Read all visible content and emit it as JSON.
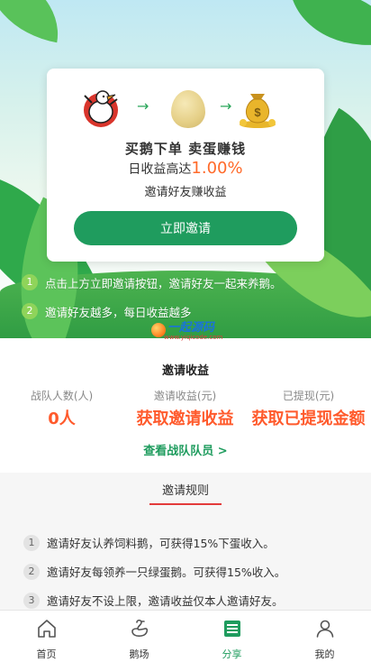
{
  "colors": {
    "accent": "#1f9c5e",
    "highlight": "#ff5a2c",
    "rules_underline": "#e33b3b"
  },
  "promo": {
    "headline": "买鹅下单  卖蛋赚钱",
    "rate_prefix": "日收益高达",
    "rate_value": "1.00%",
    "subline": "邀请好友赚收益",
    "invite_button": "立即邀请"
  },
  "steps": [
    {
      "num": "1",
      "text": "点击上方立即邀请按钮，邀请好友一起来养鹅。"
    },
    {
      "num": "2",
      "text": "邀请好友越多，每日收益越多"
    }
  ],
  "watermark": {
    "text": "一起源码",
    "url": "www.yiqicode.com"
  },
  "earnings": {
    "title": "邀请收益",
    "stats": [
      {
        "label": "战队人数(人)",
        "value": "0人"
      },
      {
        "label": "邀请收益(元)",
        "value": "获取邀请收益"
      },
      {
        "label": "已提现(元)",
        "value": "获取已提现金额"
      }
    ],
    "team_link": "查看战队队员 >"
  },
  "rules": {
    "tab": "邀请规则",
    "items": [
      {
        "num": "1",
        "text": "邀请好友认养饲料鹅，可获得15%下蛋收入。"
      },
      {
        "num": "2",
        "text": "邀请好友每领养一只绿蛋鹅。可获得15%收入。"
      },
      {
        "num": "3",
        "text": "邀请好友不设上限，邀请收益仅本人邀请好友。"
      }
    ]
  },
  "tabbar": [
    {
      "label": "首页",
      "icon": "home-icon"
    },
    {
      "label": "鹅场",
      "icon": "goose-icon"
    },
    {
      "label": "分享",
      "icon": "share-icon",
      "active": true
    },
    {
      "label": "我的",
      "icon": "user-icon"
    }
  ]
}
